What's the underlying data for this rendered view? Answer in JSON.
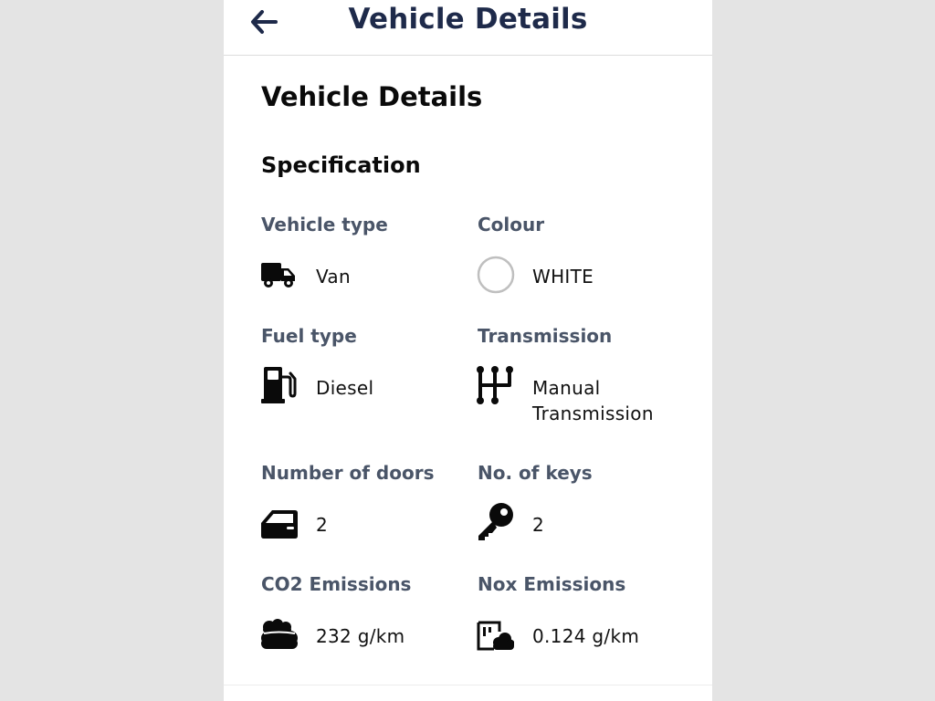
{
  "header": {
    "title": "Vehicle Details",
    "back_icon": "arrow-left-icon"
  },
  "page": {
    "title": "Vehicle Details",
    "section_title": "Specification"
  },
  "colors": {
    "header_text": "#1e2a4a",
    "label_text": "#4a5568",
    "value_text": "#111111",
    "background_outside": "#e4e4e4",
    "white_swatch_border": "#bfbfbf"
  },
  "specs": [
    {
      "label": "Vehicle type",
      "value": "Van",
      "icon": "van-icon"
    },
    {
      "label": "Colour",
      "value": "WHITE",
      "icon": "colour-swatch-icon",
      "swatch": "#ffffff"
    },
    {
      "label": "Fuel type",
      "value": "Diesel",
      "icon": "fuel-pump-icon"
    },
    {
      "label": "Transmission",
      "value_line1": "Manual",
      "value_line2": "Transmission",
      "icon": "gear-shift-icon"
    },
    {
      "label": "Number of doors",
      "value": "2",
      "icon": "car-door-icon"
    },
    {
      "label": "No. of keys",
      "value": "2",
      "icon": "key-icon"
    },
    {
      "label": "CO2 Emissions",
      "value": "232 g/km",
      "icon": "smog-cloud-icon"
    },
    {
      "label": "Nox Emissions",
      "value": "0.124 g/km",
      "icon": "emission-meter-icon"
    }
  ]
}
